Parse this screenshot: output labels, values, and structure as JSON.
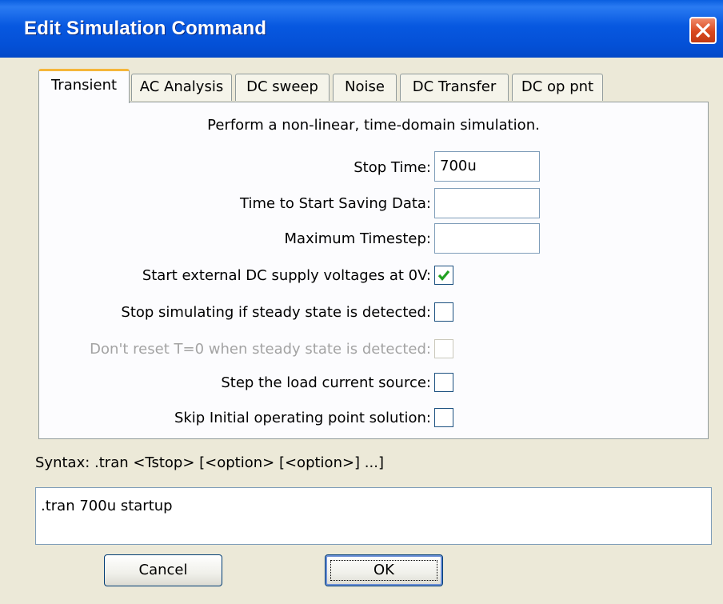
{
  "window": {
    "title": "Edit Simulation Command"
  },
  "tabs": [
    {
      "label": "Transient",
      "active": true
    },
    {
      "label": "AC Analysis"
    },
    {
      "label": "DC sweep"
    },
    {
      "label": "Noise"
    },
    {
      "label": "DC Transfer"
    },
    {
      "label": "DC op pnt"
    }
  ],
  "transient": {
    "description": "Perform a non-linear, time-domain simulation.",
    "stop_time": {
      "label": "Stop Time:",
      "value": "700u"
    },
    "start_saving": {
      "label": "Time to Start Saving Data:",
      "value": ""
    },
    "max_timestep": {
      "label": "Maximum Timestep:",
      "value": ""
    },
    "options": [
      {
        "label": "Start external DC supply voltages at 0V:",
        "checked": true,
        "disabled": false
      },
      {
        "label": "Stop simulating if steady state is detected:",
        "checked": false,
        "disabled": false
      },
      {
        "label": "Don't reset T=0 when steady state is detected:",
        "checked": false,
        "disabled": true
      },
      {
        "label": "Step the load current source:",
        "checked": false,
        "disabled": false
      },
      {
        "label": "Skip Initial operating point solution:",
        "checked": false,
        "disabled": false
      }
    ]
  },
  "syntax": "Syntax:  .tran <Tstop> [<option> [<option>] ...]",
  "command": ".tran 700u startup",
  "buttons": {
    "cancel": "Cancel",
    "ok": "OK"
  },
  "colors": {
    "titlebar": "#0450d6",
    "close": "#d9481e",
    "tab_highlight": "#f5b63a",
    "check": "#21a121"
  }
}
